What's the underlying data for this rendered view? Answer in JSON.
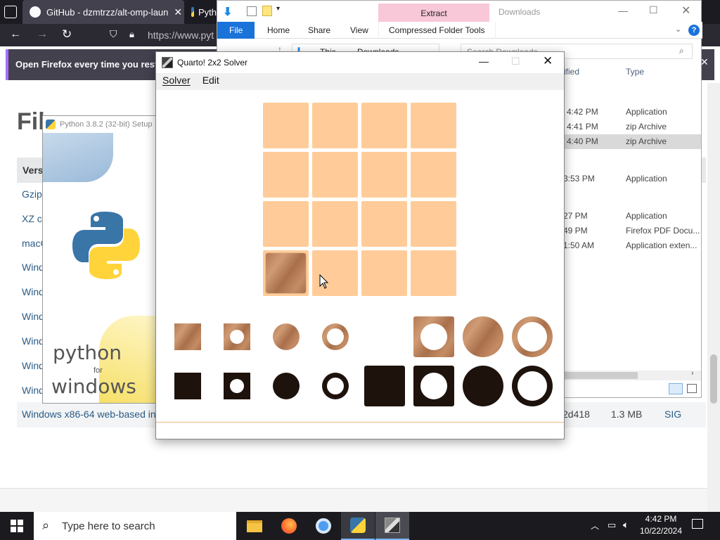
{
  "firefox": {
    "tabs": [
      {
        "label": "GitHub - dzmtrzz/alt-omp-laun"
      },
      {
        "label": "Pyth"
      }
    ],
    "url": "https://www.pyt",
    "banner_text": "Open Firefox every time you restart",
    "page": {
      "heading_partial": "Fil",
      "table_header_partial": "Versi",
      "links": [
        "Gzipp",
        "XZ cc",
        "macC",
        "Windo",
        "Windo",
        "Windo",
        "Windo",
        "Windo",
        "Windo"
      ],
      "last_row": {
        "name": "Windows x86-64 web-based ins",
        "md5": "2d418",
        "size": "1.3 MB",
        "sig": "SIG"
      }
    }
  },
  "explorer": {
    "title": "Downloads",
    "context_tab": "Extract",
    "ribbon_tabs": [
      "File",
      "Home",
      "Share",
      "View",
      "Compressed Folder Tools"
    ],
    "breadcrumb": [
      "This",
      "Downloads"
    ],
    "search_placeholder": "Search Downloads",
    "columns": {
      "modified": "ified",
      "type": "Type"
    },
    "rows": [
      {
        "time": "4:42 PM",
        "type": "Application"
      },
      {
        "time": "4:41 PM",
        "type": "zip Archive"
      },
      {
        "time": "4:40 PM",
        "type": "zip Archive"
      },
      {
        "time": "3:53 PM",
        "type": "Application"
      },
      {
        "time": "27 PM",
        "type": "Application"
      },
      {
        "time": "49 PM",
        "type": "Firefox PDF Docu..."
      },
      {
        "time": "1:50 AM",
        "type": "Application exten..."
      }
    ]
  },
  "python_installer": {
    "title": "Python 3.8.2 (32-bit) Setup",
    "brand_line1": "python",
    "brand_line2": "for",
    "brand_line3": "windows"
  },
  "quarto": {
    "title": "Quarto! 2x2 Solver",
    "menu": [
      "Solver",
      "Edit"
    ],
    "board_size": 4,
    "placed": [
      {
        "row": 3,
        "col": 0,
        "piece": "light-square-small-solid"
      }
    ],
    "colors": {
      "cell": "#ffcc99",
      "light_piece": "#b47a55",
      "dark_piece": "#1e120c"
    }
  },
  "taskbar": {
    "search_placeholder": "Type here to search",
    "time": "4:42 PM",
    "date": "10/22/2024"
  }
}
